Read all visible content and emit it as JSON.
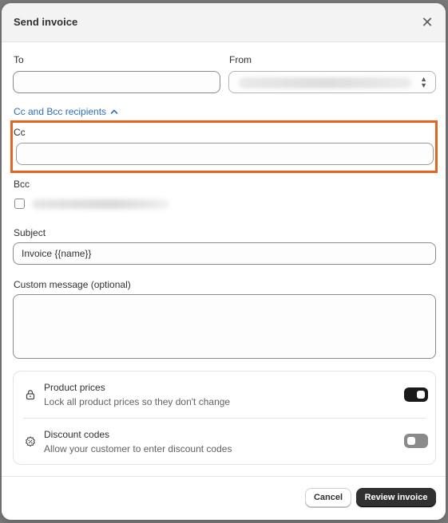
{
  "modal": {
    "title": "Send invoice",
    "close_icon": "close-icon"
  },
  "form": {
    "to": {
      "label": "To",
      "value": ""
    },
    "from": {
      "label": "From",
      "value": ""
    },
    "cc_toggle_label": "Cc and Bcc recipients",
    "cc": {
      "label": "Cc",
      "value": ""
    },
    "bcc": {
      "label": "Bcc",
      "checked": false
    },
    "subject": {
      "label": "Subject",
      "value": "Invoice {{name}}"
    },
    "message": {
      "label": "Custom message (optional)",
      "value": ""
    }
  },
  "settings": [
    {
      "title": "Product prices",
      "description": "Lock all product prices so they don't change",
      "icon": "lock-icon",
      "enabled": true
    },
    {
      "title": "Discount codes",
      "description": "Allow your customer to enter discount codes",
      "icon": "discount-icon",
      "enabled": false
    }
  ],
  "footer": {
    "cancel_label": "Cancel",
    "review_label": "Review invoice"
  },
  "colors": {
    "accent_link": "#2c6ecb",
    "highlight": "#e8631d",
    "primary_button": "#303030",
    "toggle_on": "#1a1a1a",
    "toggle_off": "#8a8a8a"
  }
}
